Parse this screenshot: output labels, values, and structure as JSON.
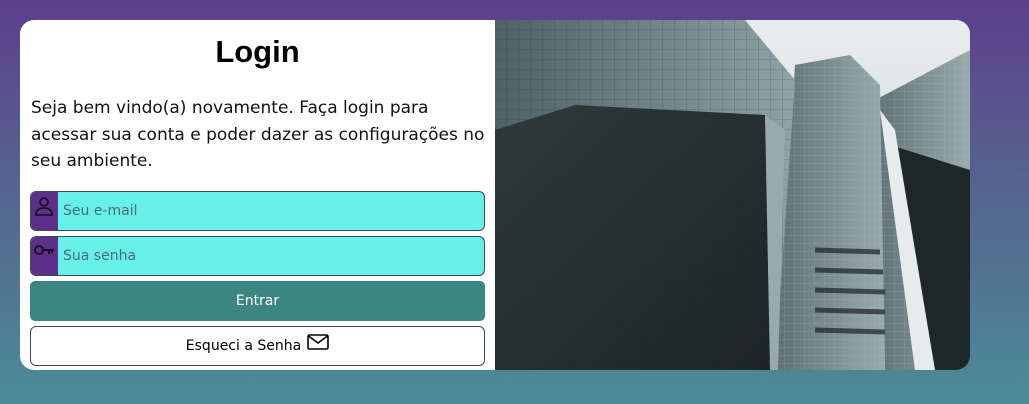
{
  "login": {
    "title": "Login",
    "intro": "Seja bem vindo(a) novamente. Faça login para acessar sua conta e poder dazer as configurações no seu ambiente.",
    "email": {
      "placeholder": "Seu e-mail",
      "icon": "user-icon"
    },
    "password": {
      "placeholder": "Sua senha",
      "icon": "key-icon"
    },
    "submit_label": "Entrar",
    "forgot_label": "Esqueci a Senha",
    "forgot_icon": "mail-icon"
  },
  "colors": {
    "field_bg": "#67efe9",
    "icon_tab": "#5e2e8b",
    "primary_button": "#3c8682",
    "bg_top": "#5d3f8c",
    "bg_bottom": "#4b8b98"
  }
}
